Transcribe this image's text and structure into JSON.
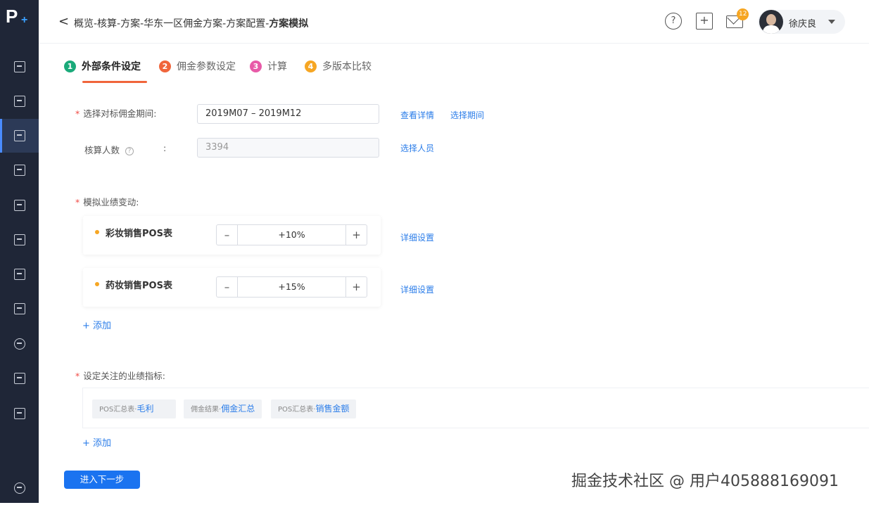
{
  "app": {
    "logo_letter": "P",
    "logo_plus": "+"
  },
  "sidebar": {
    "items": [
      {
        "icon": "apps-grid-icon"
      },
      {
        "icon": "search-report-icon"
      },
      {
        "icon": "edit-document-icon",
        "active": true
      },
      {
        "icon": "export-document-icon"
      },
      {
        "icon": "calendar-icon"
      },
      {
        "icon": "monitor-icon"
      },
      {
        "icon": "id-card-icon"
      },
      {
        "icon": "file-transfer-icon"
      },
      {
        "icon": "share-nodes-icon"
      },
      {
        "icon": "import-icon"
      },
      {
        "icon": "analytics-chart-icon"
      },
      {
        "icon": "settings-gear-icon"
      }
    ]
  },
  "header": {
    "back_icon": "<",
    "breadcrumb_path": "概览-核算-方案-华东一区佣金方案-方案配置-",
    "breadcrumb_current": "方案模拟",
    "help_glyph": "?",
    "add_glyph": "+",
    "notification_count": "12",
    "user_name": "徐庆良"
  },
  "steps": [
    {
      "num": "1",
      "label": "外部条件设定",
      "color": "#1aaa7a",
      "active": true
    },
    {
      "num": "2",
      "label": "佣金参数设定",
      "color": "#f0653b"
    },
    {
      "num": "3",
      "label": "计算",
      "color": "#e85aa8"
    },
    {
      "num": "4",
      "label": "多版本比较",
      "color": "#f6a623"
    }
  ],
  "form": {
    "period": {
      "label": "选择对标佣金期间:",
      "value": "2019M07  –  2019M12",
      "link_detail": "查看详情",
      "link_select": "选择期间"
    },
    "headcount": {
      "label": "核算人数",
      "help": "?",
      "colon": ":",
      "value": "3394",
      "link": "选择人员"
    },
    "simulate": {
      "label": "模拟业绩变动:",
      "items": [
        {
          "name": "彩妆销售POS表",
          "minus": "–",
          "value": "+10%",
          "plus": "+",
          "link": "详细设置"
        },
        {
          "name": "药妆销售POS表",
          "minus": "–",
          "value": "+15%",
          "plus": "+",
          "link": "详细设置"
        }
      ],
      "add": "+ 添加"
    },
    "metrics": {
      "label": "设定关注的业绩指标:",
      "tags": [
        {
          "prefix": "POS汇总表·",
          "name": "毛利"
        },
        {
          "prefix": "佣金结果·",
          "name": "佣金汇总"
        },
        {
          "prefix": "POS汇总表·",
          "name": "销售金额"
        }
      ],
      "add": "+ 添加"
    },
    "next_button": "进入下一步"
  },
  "watermark": "掘金技术社区 @ 用户405888169091"
}
